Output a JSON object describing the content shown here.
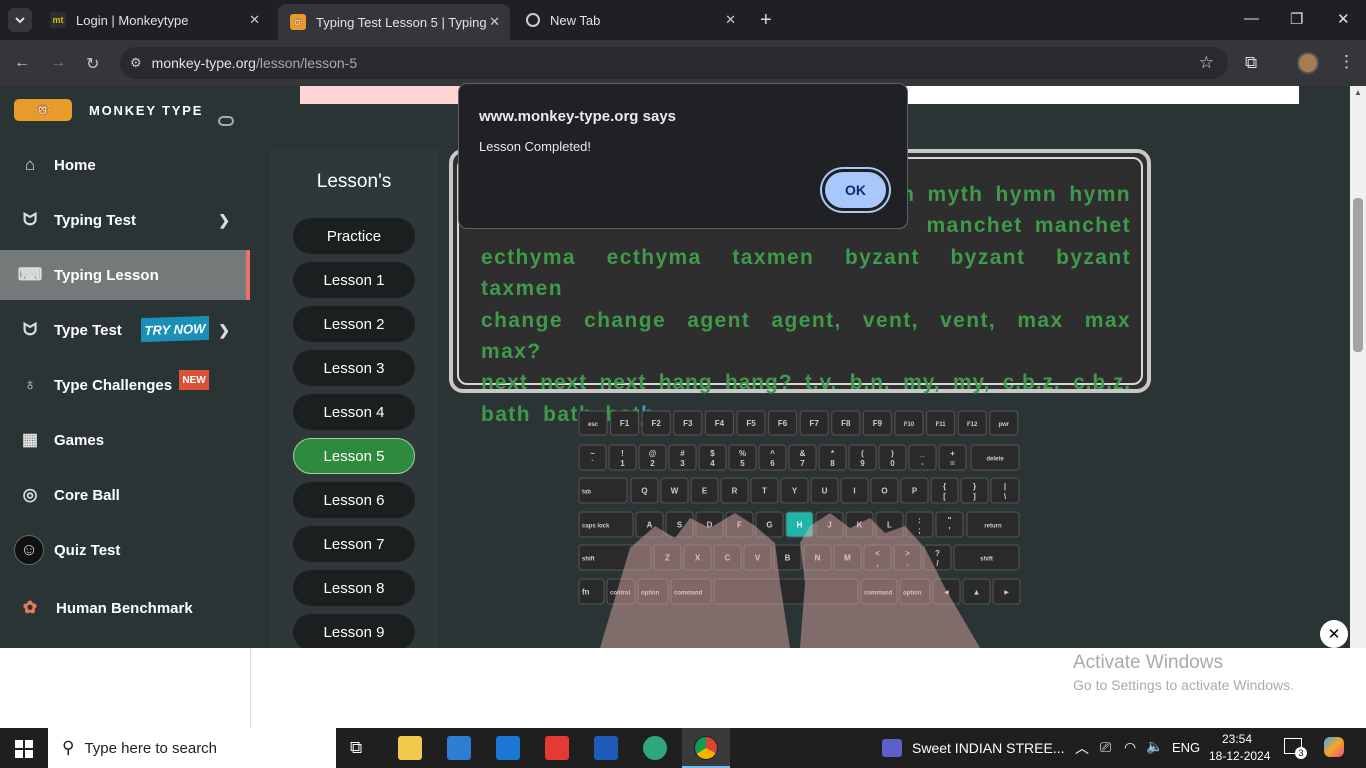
{
  "browser": {
    "tabs": [
      {
        "title": "Login | Monkeytype",
        "favicon": "mt"
      },
      {
        "title": "Typing Test Lesson 5 | Typing Te",
        "favicon": "monkey-icon"
      },
      {
        "title": "New Tab",
        "favicon": "chrome-icon"
      }
    ],
    "url_host": "monkey-type.org",
    "url_path": "/lesson/lesson-5"
  },
  "brand": {
    "name": "MONKEY TYPE"
  },
  "sidebar": {
    "items": [
      {
        "label": "Home",
        "icon": "home-icon"
      },
      {
        "label": "Typing Test",
        "icon": "cat-icon"
      },
      {
        "label": "Typing Lesson",
        "icon": "keyboard-icon"
      },
      {
        "label": "Type Test",
        "icon": "cat-icon",
        "badge": "TRY NOW"
      },
      {
        "label": "Type Challenges",
        "icon": "award-icon",
        "badge": "NEW"
      },
      {
        "label": "Games",
        "icon": "grid-icon"
      },
      {
        "label": "Core Ball",
        "icon": "target-icon"
      },
      {
        "label": "Quiz Test",
        "icon": "quiz-icon"
      },
      {
        "label": "Human Benchmark",
        "icon": "brain-icon"
      }
    ]
  },
  "lessons": {
    "heading": "Lesson's",
    "items": [
      "Practice",
      "Lesson 1",
      "Lesson 2",
      "Lesson 3",
      "Lesson 4",
      "Lesson 5",
      "Lesson 6",
      "Lesson 7",
      "Lesson 8",
      "Lesson 9"
    ],
    "active": "Lesson 5"
  },
  "typing_text": {
    "line1": "th myth hymn hymn",
    "line2": "manchet manchet",
    "line3": "ecthyma ecthyma taxmen byzant byzant byzant taxmen",
    "line4": "change change agent agent, vent, vent, max max max?",
    "line5": "next next next hang hang? t.v. b.n. my, my, c.b.z. c.b.z.",
    "line6_typed": "bath bath bat",
    "line6_current": "h"
  },
  "keyboard": {
    "highlighted_key": "H",
    "row0": [
      "esc",
      "F1",
      "F2",
      "F3",
      "F4",
      "F5",
      "F6",
      "F7",
      "F8",
      "F9",
      "F10",
      "F11",
      "F12",
      "pwr"
    ],
    "row1_top": [
      "~",
      "!",
      "@",
      "#",
      "$",
      "%",
      "^",
      "&",
      "*",
      "(",
      ")",
      "_",
      "+"
    ],
    "row1_bottom": [
      "`",
      "1",
      "2",
      "3",
      "4",
      "5",
      "6",
      "7",
      "8",
      "9",
      "0",
      "-",
      "="
    ],
    "row2": [
      "Q",
      "W",
      "E",
      "R",
      "T",
      "Y",
      "U",
      "I",
      "O",
      "P"
    ],
    "row3": [
      "A",
      "S",
      "D",
      "F",
      "G",
      "H",
      "J",
      "K",
      "L"
    ],
    "row4": [
      "Z",
      "X",
      "C",
      "V",
      "B",
      "N",
      "M"
    ],
    "labels": {
      "delete": "delete",
      "tab": "tab",
      "caps": "caps lock",
      "return": "return",
      "shift": "shift",
      "fn": "fn",
      "control": "control",
      "option": "option",
      "command": "command"
    }
  },
  "dialog": {
    "title": "www.monkey-type.org says",
    "message": "Lesson Completed!",
    "ok_label": "OK"
  },
  "watermark": {
    "line1": "Activate Windows",
    "line2": "Go to Settings to activate Windows."
  },
  "taskbar": {
    "search_placeholder": "Type here to search",
    "media_title": "Sweet INDIAN STREE...",
    "lang": "ENG",
    "time": "23:54",
    "date": "18-12-2024",
    "notif_count": "3"
  },
  "colors": {
    "accent_green": "#3f9a4c",
    "active_lesson": "#2e8b3e",
    "active_nav_border": "#ef6f6f",
    "dialog_ok": "#a8c7fa"
  }
}
